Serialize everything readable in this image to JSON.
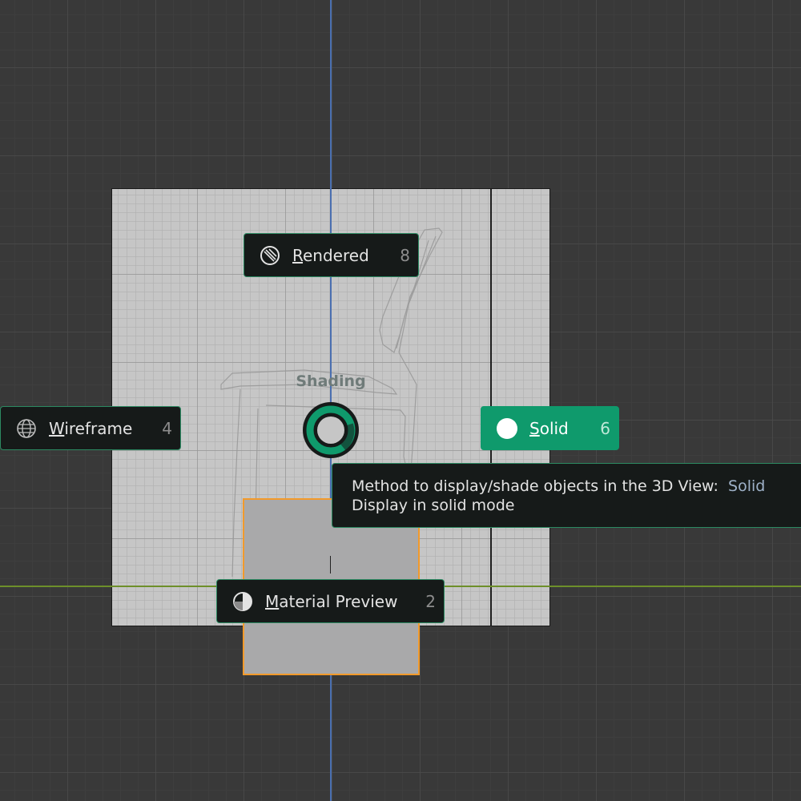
{
  "viewport": {
    "axis_y_color": "#4a6fb0",
    "axis_x_color": "#6d8f2a",
    "selection_color": "#f29a2b"
  },
  "pie_menu": {
    "title": "Shading",
    "accent_color": "#0f9a6c",
    "items": [
      {
        "id": "rendered",
        "label_first": "R",
        "label_rest": "endered",
        "shortcut": "8",
        "icon": "shading-rendered-icon",
        "active": false
      },
      {
        "id": "wireframe",
        "label_first": "W",
        "label_rest": "ireframe",
        "shortcut": "4",
        "icon": "shading-wireframe-icon",
        "active": false
      },
      {
        "id": "solid",
        "label_first": "S",
        "label_rest": "olid",
        "shortcut": "6",
        "icon": "shading-solid-icon",
        "active": true
      },
      {
        "id": "material",
        "label_first": "M",
        "label_rest": "aterial Preview",
        "shortcut": "2",
        "icon": "shading-material-icon",
        "active": false
      }
    ]
  },
  "tooltip": {
    "line1_prefix": "Method to display/shade objects in the 3D View:",
    "line1_value": "Solid",
    "line2": "Display in solid mode"
  }
}
